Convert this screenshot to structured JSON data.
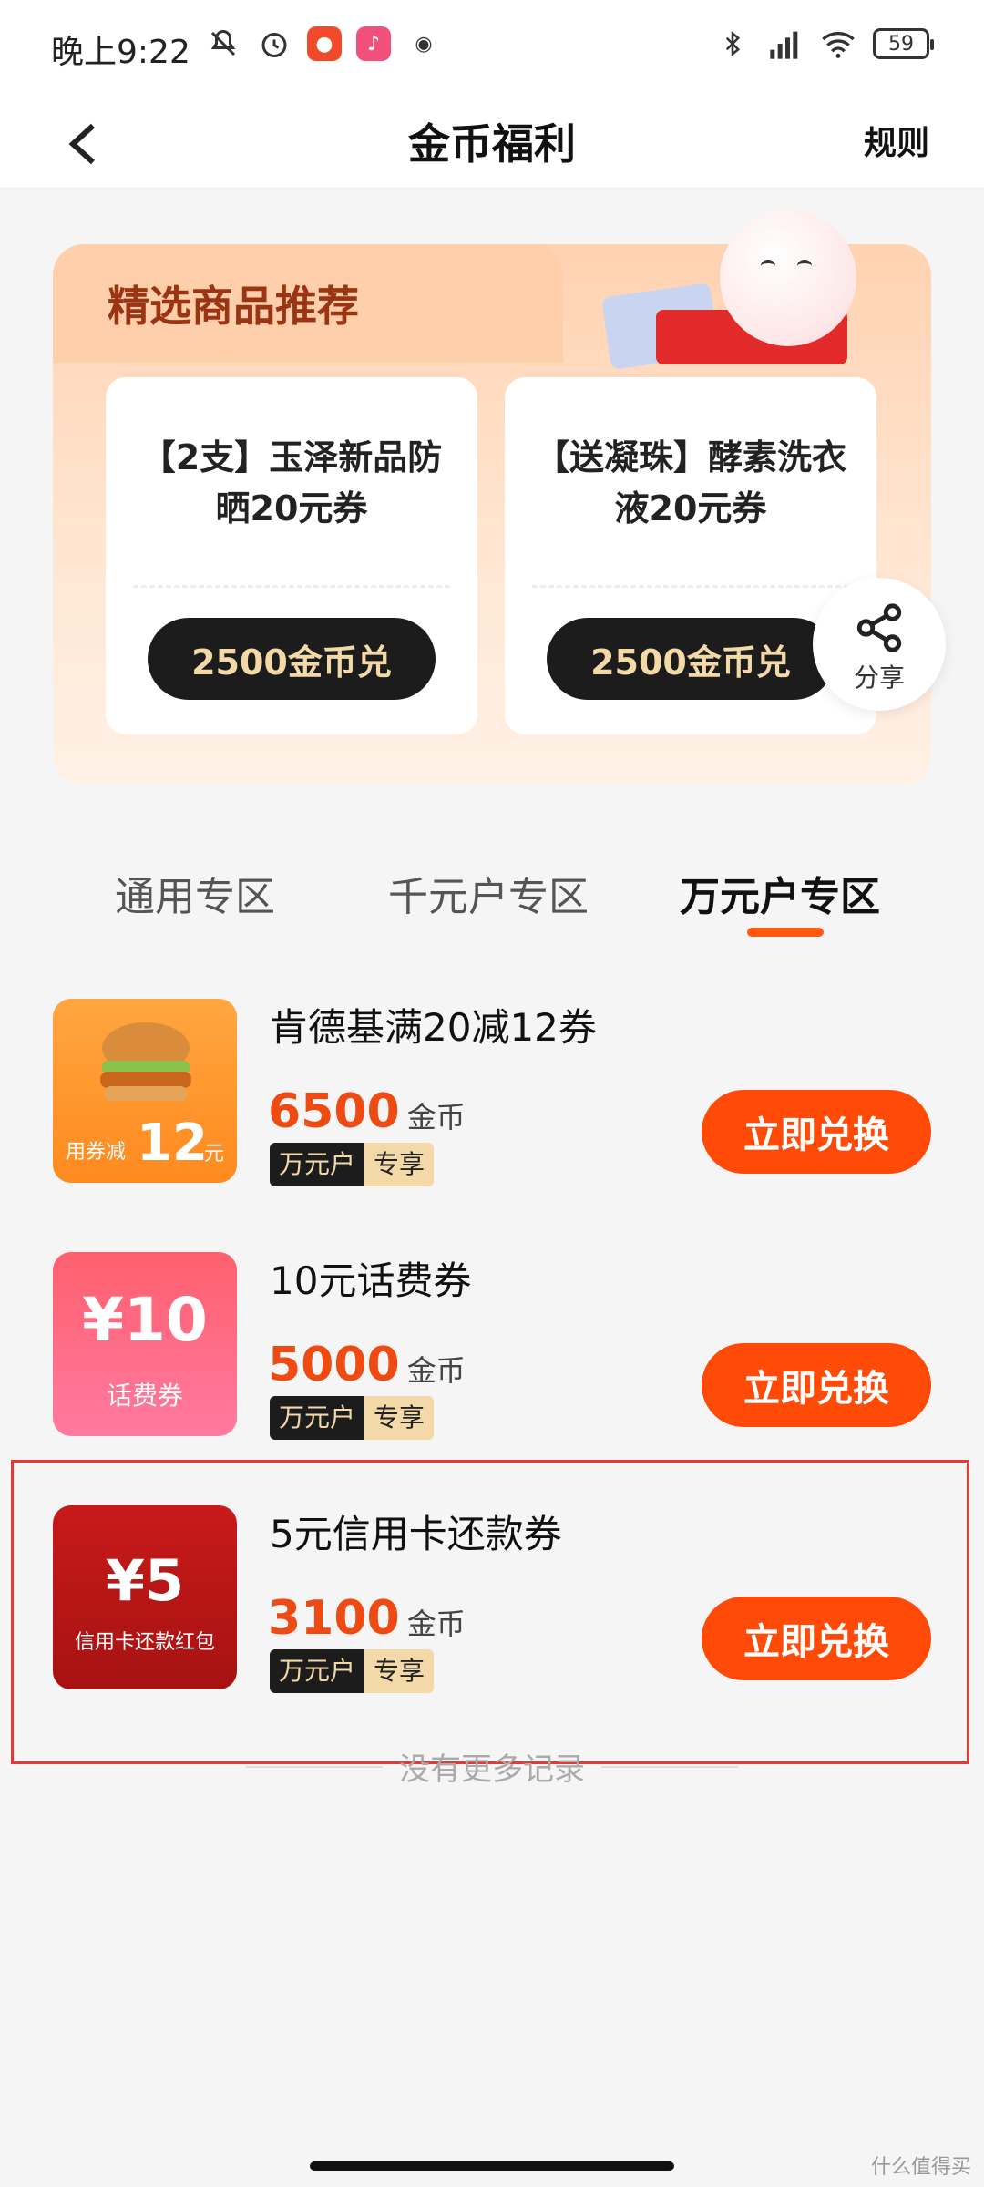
{
  "status_bar": {
    "time": "晚上9:22",
    "battery": "59"
  },
  "header": {
    "title": "金币福利",
    "rules": "规则"
  },
  "banner": {
    "title": "精选商品推荐",
    "cards": [
      {
        "name": "【2支】玉泽新品防晒20元券",
        "button": "2500金币兑"
      },
      {
        "name": "【送凝珠】酵素洗衣液20元券",
        "button": "2500金币兑"
      }
    ],
    "share_label": "分享"
  },
  "tabs": [
    {
      "label": "通用专区",
      "active": false
    },
    {
      "label": "千元户专区",
      "active": false
    },
    {
      "label": "万元户专区",
      "active": true
    }
  ],
  "items": [
    {
      "name": "肯德基满20减12券",
      "price": "6500",
      "unit": "金币",
      "tag_a": "万元户",
      "tag_b": "专享",
      "button": "立即兑换",
      "thumb": {
        "caption": "用券减",
        "amount": "12",
        "suffix": "元"
      }
    },
    {
      "name": "10元话费券",
      "price": "5000",
      "unit": "金币",
      "tag_a": "万元户",
      "tag_b": "专享",
      "button": "立即兑换",
      "thumb": {
        "amount": "¥10",
        "caption": "话费券"
      }
    },
    {
      "name": "5元信用卡还款券",
      "price": "3100",
      "unit": "金币",
      "tag_a": "万元户",
      "tag_b": "专享",
      "button": "立即兑换",
      "thumb": {
        "amount": "¥5",
        "caption": "信用卡还款红包"
      }
    }
  ],
  "end_text": "没有更多记录",
  "watermark": "什么值得买",
  "colors": {
    "accent": "#ff4b07",
    "price": "#ef4a12",
    "banner_title": "#9a3412",
    "highlight_border": "#e53935"
  }
}
